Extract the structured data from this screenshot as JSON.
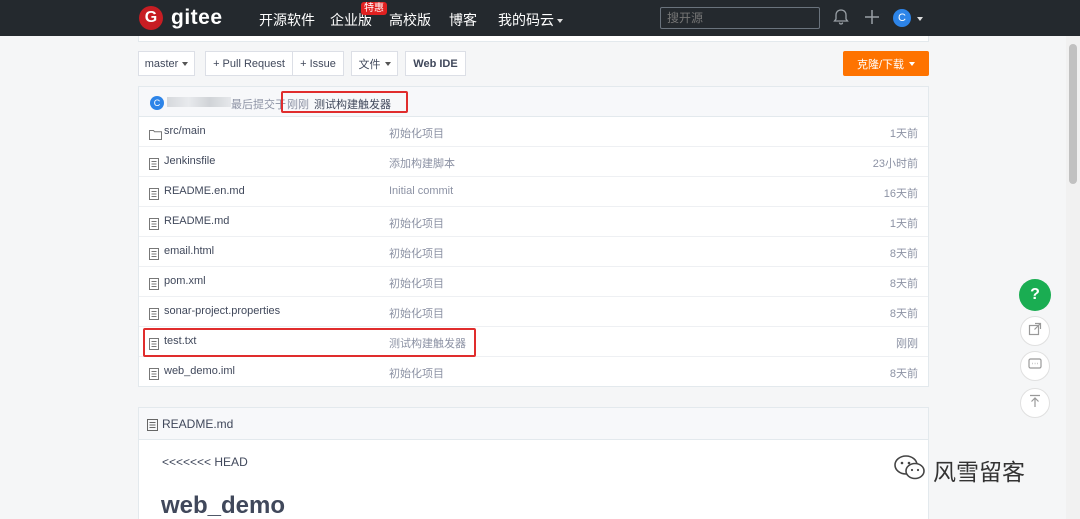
{
  "navbar": {
    "logo_letter": "G",
    "logo_text": "gitee",
    "items": [
      "开源软件",
      "企业版",
      "高校版",
      "博客",
      "我的码云"
    ],
    "enterprise_badge": "特惠",
    "search_placeholder": "搜开源",
    "user_initial": "C"
  },
  "toolbar": {
    "branch": "master",
    "pull_request": "+ Pull Request",
    "issue": "+ Issue",
    "files_menu": "文件",
    "web_ide": "Web IDE",
    "clone_download": "克隆/下载"
  },
  "last_commit": {
    "avatar_initial": "C",
    "label": "最后提交于",
    "time": "刚刚",
    "message": "测试构建触发器"
  },
  "files": [
    {
      "type": "folder",
      "name": "src/main",
      "message": "初始化项目",
      "time": "1天前"
    },
    {
      "type": "file",
      "name": "Jenkinsfile",
      "message": "添加构建脚本",
      "time": "23小时前"
    },
    {
      "type": "file",
      "name": "README.en.md",
      "message": "Initial commit",
      "time": "16天前"
    },
    {
      "type": "file",
      "name": "README.md",
      "message": "初始化项目",
      "time": "1天前"
    },
    {
      "type": "file",
      "name": "email.html",
      "message": "初始化项目",
      "time": "8天前"
    },
    {
      "type": "file",
      "name": "pom.xml",
      "message": "初始化项目",
      "time": "8天前"
    },
    {
      "type": "file",
      "name": "sonar-project.properties",
      "message": "初始化项目",
      "time": "8天前"
    },
    {
      "type": "file",
      "name": "test.txt",
      "message": "测试构建触发器",
      "time": "刚刚"
    },
    {
      "type": "file",
      "name": "web_demo.iml",
      "message": "初始化项目",
      "time": "8天前"
    }
  ],
  "readme": {
    "filename": "README.md",
    "first_line": "<<<<<<< HEAD",
    "heading": "web_demo"
  },
  "side_buttons": {
    "help": "?"
  },
  "watermark": {
    "text": "风雪留客"
  },
  "colors": {
    "navbar_bg": "#24292e",
    "brand_red": "#c71d23",
    "accent_orange": "#fe7300",
    "help_green": "#1aad52",
    "highlight_red": "#e02d2d"
  }
}
